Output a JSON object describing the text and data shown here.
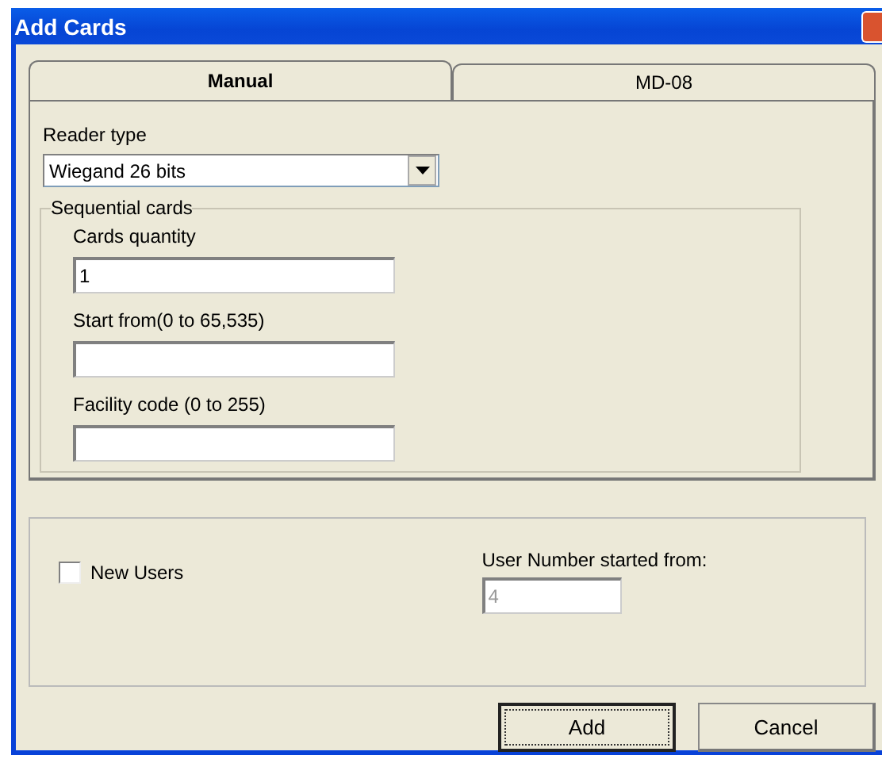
{
  "window": {
    "title": "Add Cards"
  },
  "tabs": [
    {
      "label": "Manual",
      "selected": true
    },
    {
      "label": "MD-08",
      "selected": false
    }
  ],
  "reader_type": {
    "label": "Reader type",
    "value": "Wiegand 26 bits"
  },
  "sequential_cards": {
    "title": "Sequential cards",
    "fields": [
      {
        "label": "Cards quantity",
        "value": "1"
      },
      {
        "label": "Start from(0 to 65,535)"
      },
      {
        "label": "Facility code (0 to 255)"
      }
    ]
  },
  "new_users": {
    "label": "New Users",
    "checked": false
  },
  "user_number": {
    "label": "User Number started from:",
    "value": "4",
    "disabled": true
  },
  "buttons": [
    {
      "label": "Add",
      "default": true
    },
    {
      "label": "Cancel",
      "default": false
    }
  ]
}
